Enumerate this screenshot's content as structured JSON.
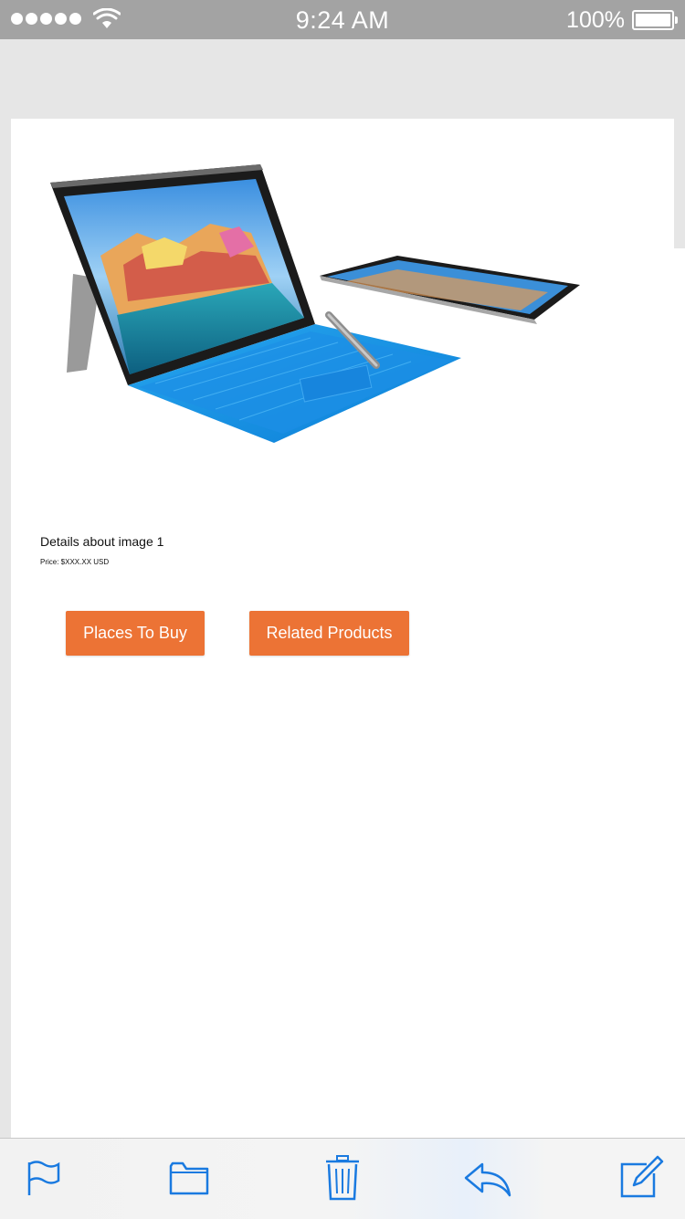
{
  "status_bar": {
    "time": "9:24 AM",
    "battery_percent": "100%",
    "signal_icon": "cellular-dots-icon",
    "wifi_icon": "wifi-icon",
    "battery_icon": "battery-full-icon"
  },
  "product": {
    "image_alt": "Surface Pro 4 with blue keyboard cover and pen",
    "details_title": "Details about image 1",
    "price": "Price: $XXX.XX USD"
  },
  "buttons": {
    "places_to_buy": "Places To Buy",
    "related_products": "Related Products"
  },
  "toolbar": {
    "items": [
      "flag-icon",
      "folder-icon",
      "trash-icon",
      "reply-icon",
      "compose-icon"
    ]
  },
  "colors": {
    "accent": "#ec7335",
    "toolbar_icon": "#1a7ae0",
    "status_bar": "#a3a3a3"
  }
}
